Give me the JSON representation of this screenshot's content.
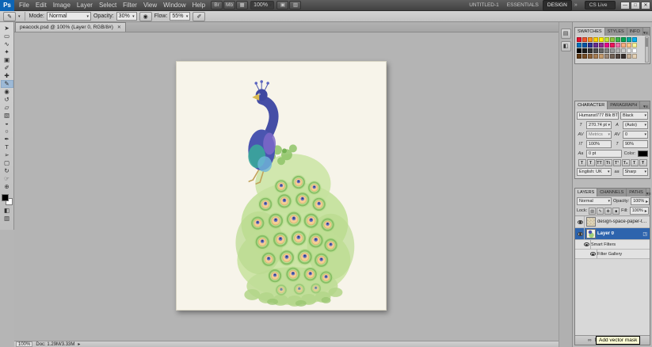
{
  "colors": {
    "selection": "#2e64ad",
    "tooltip-bg": "#ffffd5",
    "accent-blue": "#0d65b5"
  },
  "app": {
    "logo": "Ps",
    "menu": [
      "File",
      "Edit",
      "Image",
      "Layer",
      "Select",
      "Filter",
      "View",
      "Window",
      "Help"
    ],
    "appbar_icons": [
      {
        "id": "bridge-launch-icon",
        "glyph": "Br"
      },
      {
        "id": "mini-bridge-icon",
        "glyph": "Mb"
      },
      {
        "id": "view-extras-icon",
        "glyph": "▦"
      }
    ],
    "zoom_level": "100%",
    "appbar_icons_right": [
      {
        "id": "arrange-documents-icon",
        "glyph": "▣"
      },
      {
        "id": "screen-mode-icon",
        "glyph": "▥"
      }
    ],
    "workspaces": [
      "UNTITLED-1",
      "ESSENTIALS",
      "DESIGN"
    ],
    "active_workspace": "DESIGN",
    "workspace_overflow": "»",
    "cs_live_label": "CS Live",
    "window_controls": [
      "—",
      "□",
      "✕"
    ]
  },
  "options_bar": {
    "preset_icon": "✎",
    "mode_label": "Mode:",
    "mode_value": "Normal",
    "opacity_label": "Opacity:",
    "opacity_value": "30%",
    "tablet_icon": "◉",
    "flow_label": "Flow:",
    "flow_value": "55%",
    "airbrush_icon": "✐"
  },
  "document_tab": {
    "title": "peacock.psd @ 100% (Layer 0, RGB/8#)"
  },
  "tools": [
    {
      "id": "move",
      "glyph": "➤"
    },
    {
      "id": "rectangular-marquee",
      "glyph": "▭"
    },
    {
      "id": "lasso",
      "glyph": "∿"
    },
    {
      "id": "quick-selection",
      "glyph": "✦"
    },
    {
      "id": "crop",
      "glyph": "▣"
    },
    {
      "id": "eyedropper",
      "glyph": "✐"
    },
    {
      "id": "spot-healing",
      "glyph": "✚"
    },
    {
      "id": "brush",
      "glyph": "✎",
      "selected": true
    },
    {
      "id": "clone-stamp",
      "glyph": "◉"
    },
    {
      "id": "history-brush",
      "glyph": "↺"
    },
    {
      "id": "eraser",
      "glyph": "▱"
    },
    {
      "id": "gradient",
      "glyph": "▧"
    },
    {
      "id": "blur",
      "glyph": "◒"
    },
    {
      "id": "dodge",
      "glyph": "○"
    },
    {
      "id": "pen",
      "glyph": "✒"
    },
    {
      "id": "type",
      "glyph": "T"
    },
    {
      "id": "path-selection",
      "glyph": "➢"
    },
    {
      "id": "rectangle-shape",
      "glyph": "▢"
    },
    {
      "id": "rotate-3d",
      "glyph": "↻"
    },
    {
      "id": "hand",
      "glyph": "☞"
    },
    {
      "id": "zoom",
      "glyph": "⊕"
    }
  ],
  "tools_bottom": [
    {
      "id": "quick-mask",
      "glyph": "◧"
    },
    {
      "id": "screen-mode-toggle",
      "glyph": "▥"
    }
  ],
  "dock_icons": [
    {
      "id": "history-panel-icon",
      "glyph": "▤"
    },
    {
      "id": "properties-panel-icon",
      "glyph": "◧"
    }
  ],
  "panels": {
    "swatches": {
      "tabs": [
        "SWATCHES",
        "STYLES",
        "INFO"
      ],
      "active_tab": "SWATCHES",
      "colors": [
        "#e8112d",
        "#f2552c",
        "#f7941e",
        "#ffd400",
        "#fff200",
        "#c4e538",
        "#8dc63f",
        "#39b54a",
        "#00a651",
        "#00a99d",
        "#00aeef",
        "#0072bc",
        "#0054a6",
        "#2e3192",
        "#662d91",
        "#92278f",
        "#ec008c",
        "#ed145b",
        "#f06eaa",
        "#f9ad81",
        "#fdc689",
        "#fff799",
        "#000000",
        "#1a1a1a",
        "#333333",
        "#4d4d4d",
        "#666666",
        "#808080",
        "#999999",
        "#b3b3b3",
        "#cccccc",
        "#e6e6e6",
        "#ffffff",
        "#603913",
        "#754c24",
        "#8c6239",
        "#a67c52",
        "#c69c6d",
        "#998675",
        "#736357",
        "#534741",
        "#362f2d",
        "#c7b299",
        "#e6d2b5"
      ]
    },
    "character": {
      "tabs": [
        "CHARACTER",
        "PARAGRAPH"
      ],
      "active_tab": "CHARACTER",
      "font_family": "Humanst777 Blk BT",
      "font_style": "Black",
      "size_icon": "T",
      "font_size": "270.74 pt",
      "leading_icon": "A",
      "leading": "(Auto)",
      "kern_icon": "AV",
      "kerning": "Metrics",
      "track_icon": "AV",
      "tracking": "0",
      "vscale_icon": "IT",
      "vertical_scale": "100%",
      "hscale_icon": "T",
      "horizontal_scale": "90%",
      "baseline_icon": "Aa",
      "baseline_shift": "0 pt",
      "color_label": "Color:",
      "style_buttons": [
        "T",
        "T",
        "TT",
        "Tt",
        "T¹",
        "T₁",
        "T",
        "Ŧ"
      ],
      "language": "English: UK",
      "antialias_icon": "aa",
      "antialias": "Sharp"
    },
    "layers": {
      "tabs": [
        "LAYERS",
        "CHANNELS",
        "PATHS"
      ],
      "active_tab": "LAYERS",
      "blend_mode": "Normal",
      "opacity_label": "Opacity:",
      "opacity_value": "100%",
      "lock_label": "Lock:",
      "lock_icons": [
        "▨",
        "✎",
        "✥",
        "■"
      ],
      "fill_label": "Fill:",
      "fill_value": "100%",
      "rows": [
        {
          "label": "design-space-paper-texture...",
          "indent": 0,
          "eye": true,
          "thumb": "texture",
          "selected": false
        },
        {
          "label": "Layer 0",
          "indent": 0,
          "eye": true,
          "thumb": "peacock",
          "selected": true,
          "badge": "◳"
        },
        {
          "label": "Smart Filters",
          "indent": 1,
          "eye": true,
          "sub": true
        },
        {
          "label": "Filter Gallery",
          "indent": 2,
          "eye": true,
          "sub": true
        }
      ],
      "bottom_icons": [
        {
          "id": "link-layers-icon",
          "glyph": "∞"
        },
        {
          "id": "layer-style-icon",
          "glyph": "fx"
        },
        {
          "id": "add-layer-mask-icon",
          "glyph": "◘"
        },
        {
          "id": "adjustment-layer-icon",
          "glyph": "◑"
        },
        {
          "id": "layer-group-icon",
          "glyph": "❏"
        },
        {
          "id": "new-layer-icon",
          "glyph": "⊞"
        },
        {
          "id": "delete-layer-icon",
          "glyph": "⌦"
        }
      ]
    }
  },
  "status_bar": {
    "zoom": "100%",
    "doc_label": "Doc: 1.29M/3.33M"
  },
  "tooltip": {
    "text": "Add vector mask"
  }
}
